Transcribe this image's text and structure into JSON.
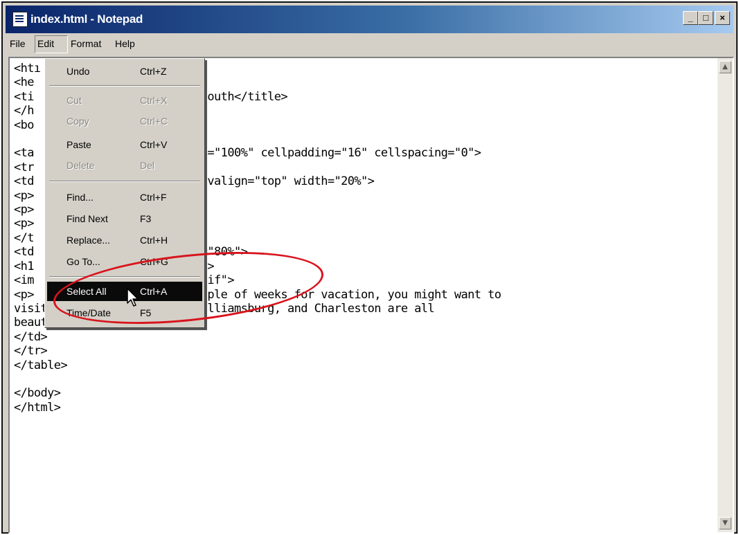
{
  "window": {
    "title": "index.html - Notepad",
    "controls": {
      "minimize": "_",
      "maximize": "□",
      "close": "×"
    }
  },
  "menubar": {
    "file": "File",
    "edit": "Edit",
    "format": "Format",
    "help": "Help"
  },
  "edit_menu": {
    "items": [
      {
        "label": "Undo",
        "shortcut": "Ctrl+Z",
        "enabled": true
      },
      {
        "label": "Cut",
        "shortcut": "Ctrl+X",
        "enabled": false
      },
      {
        "label": "Copy",
        "shortcut": "Ctrl+C",
        "enabled": false
      },
      {
        "label": "Paste",
        "shortcut": "Ctrl+V",
        "enabled": true
      },
      {
        "label": "Delete",
        "shortcut": "Del",
        "enabled": false
      },
      {
        "label": "Find...",
        "shortcut": "Ctrl+F",
        "enabled": true
      },
      {
        "label": "Find Next",
        "shortcut": "F3",
        "enabled": true
      },
      {
        "label": "Replace...",
        "shortcut": "Ctrl+H",
        "enabled": true
      },
      {
        "label": "Go To...",
        "shortcut": "Ctrl+G",
        "enabled": true
      },
      {
        "label": "Select All",
        "shortcut": "Ctrl+A",
        "enabled": true,
        "highlighted": true
      },
      {
        "label": "Time/Date",
        "shortcut": "F5",
        "enabled": true
      }
    ]
  },
  "editor": {
    "lines": [
      "<htı",
      "<he",
      "<ti",
      "</h",
      "<bo",
      "",
      "<ta",
      "<tr",
      "<td",
      "<p>",
      "<p>",
      "<p>",
      "</t",
      "<td",
      "<h1",
      "<im",
      "<p>",
      "visit the South. Richmond, Williamsburg, and Charleston are all",
      "beautiful cities.</p>",
      "</td>",
      "</tr>",
      "</table>",
      "",
      "</body>",
      "</html>"
    ],
    "visible_fragments": [
      "n South</title>",
      "dth=\"100%\" cellpadding=\"16\" cellspacing=\"0\">",
      "t\" valign=\"top\" width=\"20%\">",
      "th=\"80%\">",
      "/h1>",
      "va.gif\">",
      "couple of weeks for vacation, you might want to"
    ]
  },
  "annotation": {
    "color": "#d8141c"
  }
}
